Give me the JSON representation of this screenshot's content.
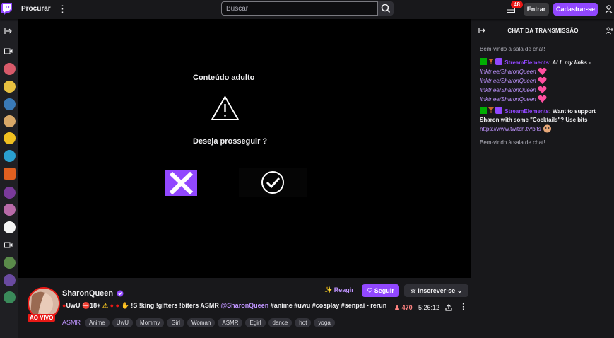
{
  "topbar": {
    "browse_label": "Procurar",
    "search_placeholder": "Buscar",
    "notifications_count": "48",
    "login_label": "Entrar",
    "signup_label": "Cadastrar-se"
  },
  "player": {
    "overlay_title": "Conteúdo adulto",
    "overlay_question": "Deseja prosseguir ?"
  },
  "chat": {
    "title": "CHAT DA TRANSMISSÃO",
    "welcome_1": "Bem-vindo à sala de chat!",
    "msg1_user": "StreamElements",
    "msg1_text": "ALL my links -",
    "msg1_links": [
      "linktr.ee/SharonQueen",
      "linktr.ee/SharonQueen",
      "linktr.ee/SharonQueen",
      "linktr.ee/SharonQueen"
    ],
    "msg2_user": "StreamElements",
    "msg2_text": "Want to support Sharon with some \"Cocktails\"? Use bits–",
    "msg2_link": "https://www.twitch.tv/bits",
    "welcome_2": "Bem-vindo à sala de chat!"
  },
  "channel": {
    "live_label": "AO VIVO",
    "name": "SharonQueen",
    "title_part1": "UwU",
    "title_part2": "18+",
    "title_part3": "!S !king !gifters !biters ASMR",
    "title_mention": "@SharonQueen",
    "title_part4": "#anime #uwu #cosplay #senpai - rerun",
    "category": "ASMR",
    "tags": [
      "Anime",
      "UwU",
      "Mommy",
      "Girl",
      "Woman",
      "ASMR",
      "Egirl",
      "dance",
      "hot",
      "yoga"
    ],
    "react_label": "Reagir",
    "follow_label": "Seguir",
    "subscribe_label": "Inscrever-se",
    "viewers": "470",
    "uptime": "5:26:12"
  },
  "colors": {
    "accent": "#9147ff",
    "live": "#e91916",
    "background": "#0e0e10"
  }
}
